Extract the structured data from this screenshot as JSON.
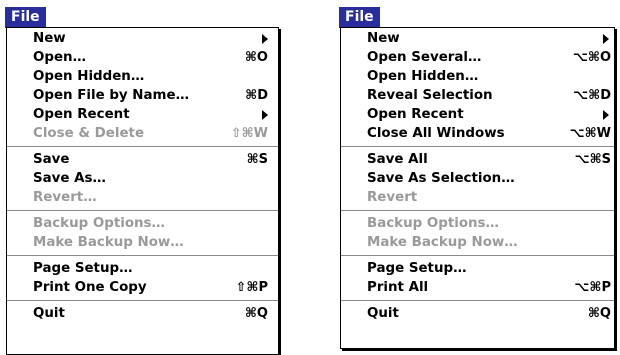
{
  "menus": [
    {
      "title": "File",
      "groups": [
        [
          {
            "label": "New",
            "submenu": true
          },
          {
            "label": "Open…",
            "shortcut": "⌘O"
          },
          {
            "label": "Open Hidden…"
          },
          {
            "label": "Open File by Name…",
            "shortcut": "⌘D"
          },
          {
            "label": "Open Recent",
            "submenu": true
          },
          {
            "label": "Close & Delete",
            "shortcut": "⇧⌘W",
            "disabled": true
          }
        ],
        [
          {
            "label": "Save",
            "shortcut": "⌘S"
          },
          {
            "label": "Save As…"
          },
          {
            "label": "Revert…",
            "disabled": true
          }
        ],
        [
          {
            "label": "Backup Options…",
            "disabled": true
          },
          {
            "label": "Make Backup Now…",
            "disabled": true
          }
        ],
        [
          {
            "label": "Page Setup…"
          },
          {
            "label": "Print One Copy",
            "shortcut": "⇧⌘P"
          }
        ],
        [
          {
            "label": "Quit",
            "shortcut": "⌘Q"
          }
        ]
      ]
    },
    {
      "title": "File",
      "groups": [
        [
          {
            "label": "New",
            "submenu": true
          },
          {
            "label": "Open Several…",
            "shortcut": "⌥⌘O"
          },
          {
            "label": "Open Hidden…"
          },
          {
            "label": "Reveal Selection",
            "shortcut": "⌥⌘D"
          },
          {
            "label": "Open Recent",
            "submenu": true
          },
          {
            "label": "Close All Windows",
            "shortcut": "⌥⌘W"
          }
        ],
        [
          {
            "label": "Save All",
            "shortcut": "⌥⌘S"
          },
          {
            "label": "Save As Selection…"
          },
          {
            "label": "Revert",
            "disabled": true
          }
        ],
        [
          {
            "label": "Backup Options…",
            "disabled": true
          },
          {
            "label": "Make Backup Now…",
            "disabled": true
          }
        ],
        [
          {
            "label": "Page Setup…"
          },
          {
            "label": "Print All",
            "shortcut": "⌥⌘P"
          }
        ],
        [
          {
            "label": "Quit",
            "shortcut": "⌘Q"
          }
        ]
      ]
    }
  ]
}
